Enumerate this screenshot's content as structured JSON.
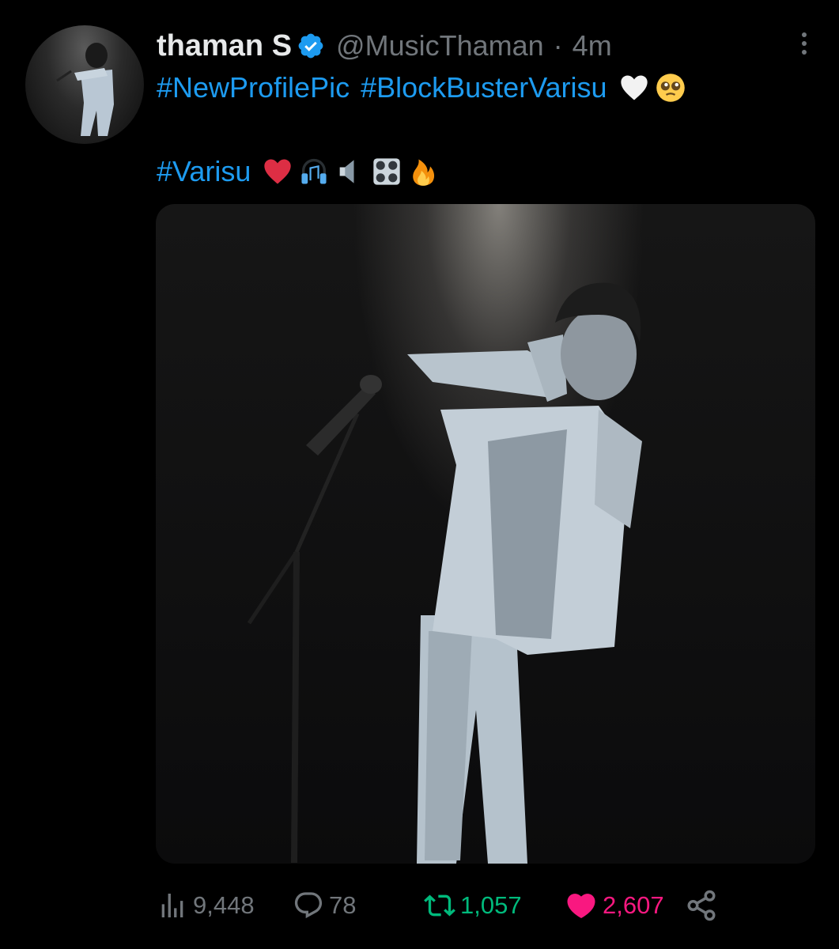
{
  "tweet": {
    "author_name": "thaman S",
    "handle": "@MusicThaman",
    "separator": "·",
    "time": "4m",
    "line1": {
      "hashtag1": "#NewProfilePic",
      "hashtag2": "#BlockBusterVarisu",
      "emojis": [
        "white-heart",
        "pleading-face"
      ]
    },
    "line2": {
      "hashtag": "#Varisu",
      "emojis": [
        "red-heart",
        "headphones",
        "speaker-low-volume",
        "control-knobs",
        "fire"
      ]
    }
  },
  "media": {
    "icon": "photo-performer-with-microphone"
  },
  "actions": {
    "views": "9,448",
    "replies": "78",
    "retweets": "1,057",
    "likes": "2,607"
  },
  "colors": {
    "background": "#000000",
    "link": "#1d9bf0",
    "muted": "#71767b",
    "retweet": "#00ba7c",
    "like": "#f91880",
    "verified": "#1d9bf0"
  }
}
